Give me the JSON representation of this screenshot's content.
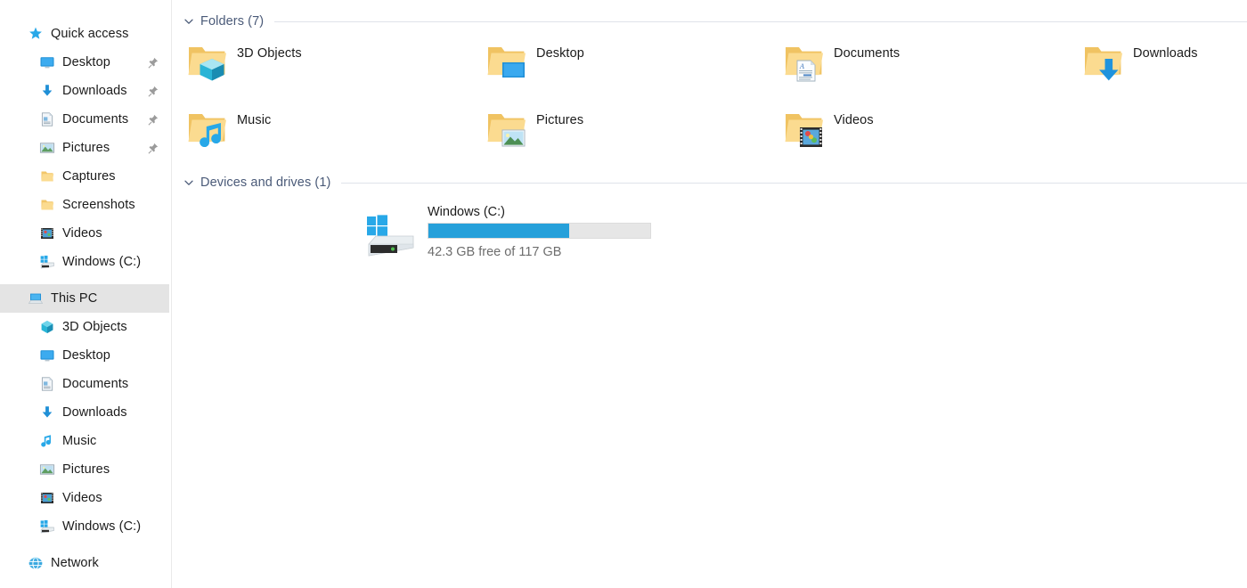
{
  "sidebar": {
    "items": [
      {
        "label": "Quick access",
        "icon": "star-icon",
        "level": 0,
        "pinned": false,
        "selected": false
      },
      {
        "label": "Desktop",
        "icon": "desktop-icon",
        "level": 1,
        "pinned": true,
        "selected": false
      },
      {
        "label": "Downloads",
        "icon": "download-icon",
        "level": 1,
        "pinned": true,
        "selected": false
      },
      {
        "label": "Documents",
        "icon": "documents-icon",
        "level": 1,
        "pinned": true,
        "selected": false
      },
      {
        "label": "Pictures",
        "icon": "pictures-icon",
        "level": 1,
        "pinned": true,
        "selected": false
      },
      {
        "label": "Captures",
        "icon": "folder-icon",
        "level": 1,
        "pinned": false,
        "selected": false
      },
      {
        "label": "Screenshots",
        "icon": "folder-icon",
        "level": 1,
        "pinned": false,
        "selected": false
      },
      {
        "label": "Videos",
        "icon": "videos-icon",
        "level": 1,
        "pinned": false,
        "selected": false
      },
      {
        "label": "Windows (C:)",
        "icon": "drive-icon",
        "level": 1,
        "pinned": false,
        "selected": false
      },
      {
        "label": "This PC",
        "icon": "this-pc-icon",
        "level": 0,
        "pinned": false,
        "selected": true
      },
      {
        "label": "3D Objects",
        "icon": "3d-objects-icon",
        "level": 1,
        "pinned": false,
        "selected": false
      },
      {
        "label": "Desktop",
        "icon": "desktop-icon",
        "level": 1,
        "pinned": false,
        "selected": false
      },
      {
        "label": "Documents",
        "icon": "documents-icon",
        "level": 1,
        "pinned": false,
        "selected": false
      },
      {
        "label": "Downloads",
        "icon": "download-icon",
        "level": 1,
        "pinned": false,
        "selected": false
      },
      {
        "label": "Music",
        "icon": "music-icon",
        "level": 1,
        "pinned": false,
        "selected": false
      },
      {
        "label": "Pictures",
        "icon": "pictures-icon",
        "level": 1,
        "pinned": false,
        "selected": false
      },
      {
        "label": "Videos",
        "icon": "videos-icon",
        "level": 1,
        "pinned": false,
        "selected": false
      },
      {
        "label": "Windows (C:)",
        "icon": "drive-icon",
        "level": 1,
        "pinned": false,
        "selected": false
      },
      {
        "label": "Network",
        "icon": "network-icon",
        "level": 0,
        "pinned": false,
        "selected": false
      }
    ]
  },
  "main": {
    "groups": [
      {
        "title": "Folders (7)",
        "chevron": "chevron-down-icon",
        "items": [
          {
            "label": "3D Objects",
            "icon": "folder-3d-objects-icon"
          },
          {
            "label": "Desktop",
            "icon": "folder-desktop-icon"
          },
          {
            "label": "Documents",
            "icon": "folder-documents-icon"
          },
          {
            "label": "Downloads",
            "icon": "folder-downloads-icon"
          },
          {
            "label": "Music",
            "icon": "folder-music-icon"
          },
          {
            "label": "Pictures",
            "icon": "folder-pictures-icon"
          },
          {
            "label": "Videos",
            "icon": "folder-videos-icon"
          }
        ]
      },
      {
        "title": "Devices and drives (1)",
        "chevron": "chevron-down-icon",
        "items": [
          {
            "label": "Windows (C:)",
            "icon": "hard-drive-windows-icon",
            "free_text": "42.3 GB free of 117 GB",
            "used_percent": 63.5
          }
        ]
      }
    ]
  },
  "colors": {
    "accent_blue": "#26a0da",
    "folder_yellow": "#f7d279",
    "group_header_text": "#4a5a78",
    "selection_gray": "#e4e4e4",
    "muted_text": "#6d6d6d"
  }
}
